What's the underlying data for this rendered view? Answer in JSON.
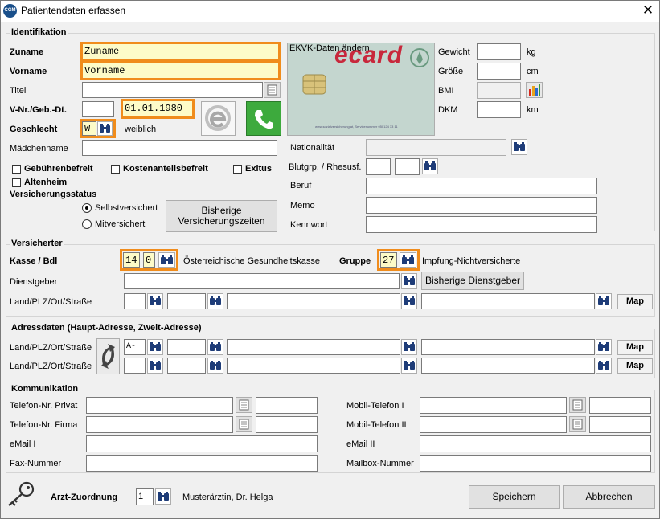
{
  "window": {
    "title": "Patientendaten erfassen",
    "app_icon_text": "CGM"
  },
  "ident": {
    "group_label": "Identifikation",
    "zuname_label": "Zuname",
    "zuname_value": "Zuname",
    "vorname_label": "Vorname",
    "vorname_value": "Vorname",
    "titel_label": "Titel",
    "vnr_label": "V-Nr./Geb.-Dt.",
    "gebdt_value": "01.01.1980",
    "geschlecht_label": "Geschlecht",
    "geschlecht_value": "W",
    "geschlecht_text": "weiblich",
    "maedchenname_label": "Mädchenname",
    "gebuehrenbefreit_label": "Gebührenbefreit",
    "kostenanteilsbefreit_label": "Kostenanteilsbefreit",
    "exitus_label": "Exitus",
    "altenheim_label": "Altenheim",
    "versstatus_label": "Versicherungsstatus",
    "selbst_label": "Selbstversichert",
    "mit_label": "Mitversichert",
    "bisherige_vers_btn_line1": "Bisherige",
    "bisherige_vers_btn_line2": "Versicherungszeiten",
    "ecard_caption": "EKVK-Daten ändern",
    "ecard_logo": "ecard",
    "ecard_small": "www.sozialversicherung.at, Servicenummer 050124 33 11",
    "gewicht_label": "Gewicht",
    "gewicht_unit": "kg",
    "groesse_label": "Größe",
    "groesse_unit": "cm",
    "bmi_label": "BMI",
    "dkm_label": "DKM",
    "dkm_unit": "km",
    "nationalitaet_label": "Nationalität",
    "blutgruppe_label": "Blutgrp. / Rhesusf.",
    "beruf_label": "Beruf",
    "memo_label": "Memo",
    "kennwort_label": "Kennwort"
  },
  "versicherter": {
    "group_label": "Versicherter",
    "kasse_label": "Kasse / Bdl",
    "kasse_value": "14",
    "bdl_value": "0",
    "kasse_text": "Österreichische Gesundheitskasse",
    "gruppe_label": "Gruppe",
    "gruppe_value": "27",
    "gruppe_text": "Impfung-Nichtversicherte",
    "dienstgeber_label": "Dienstgeber",
    "bisherige_dg_btn": "Bisherige Dienstgeber",
    "land_label": "Land/PLZ/Ort/Straße",
    "map_label": "Map"
  },
  "adresse": {
    "group_label": "Adressdaten (Haupt-Adresse, Zweit-Adresse)",
    "land1_label": "Land/PLZ/Ort/Straße",
    "land1_value": "A-",
    "land2_label": "Land/PLZ/Ort/Straße",
    "map_label": "Map"
  },
  "kommunikation": {
    "group_label": "Kommunikation",
    "tel_privat_label": "Telefon-Nr. Privat",
    "tel_firma_label": "Telefon-Nr. Firma",
    "email1_label": "eMail I",
    "fax_label": "Fax-Nummer",
    "mobil1_label": "Mobil-Telefon I",
    "mobil2_label": "Mobil-Telefon II",
    "email2_label": "eMail II",
    "mailbox_label": "Mailbox-Nummer"
  },
  "footer": {
    "arzt_label": "Arzt-Zuordnung",
    "arzt_value": "1",
    "arzt_name": "Musterärztin, Dr. Helga",
    "save_label": "Speichern",
    "cancel_label": "Abbrechen"
  },
  "colors": {
    "highlight_border": "#f08c1c",
    "highlight_fill": "#fdfbc8",
    "phone_green": "#3daa3d",
    "ecard_bg": "#c4d6cf"
  }
}
